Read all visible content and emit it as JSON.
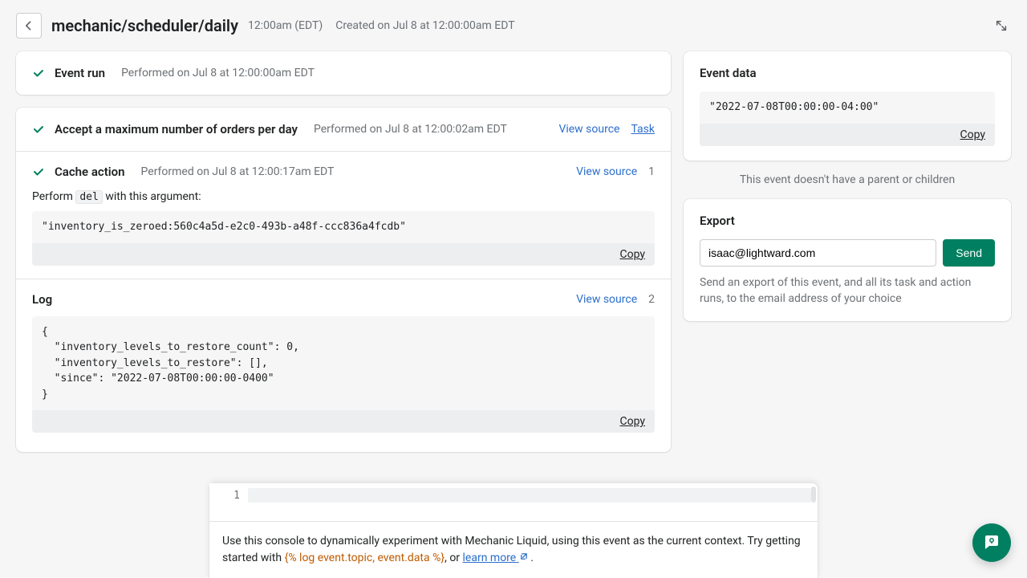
{
  "header": {
    "title": "mechanic/scheduler/daily",
    "time": "12:00am (EDT)",
    "created": "Created on Jul 8 at 12:00:00am EDT"
  },
  "event_run": {
    "title": "Event run",
    "performed": "Performed on Jul 8 at 12:00:00am EDT"
  },
  "task_run": {
    "title": "Accept a maximum number of orders per day",
    "performed": "Performed on Jul 8 at 12:00:02am EDT",
    "view_source": "View source",
    "task_link": "Task"
  },
  "cache_action": {
    "title": "Cache action",
    "performed": "Performed on Jul 8 at 12:00:17am EDT",
    "view_source": "View source",
    "badge": "1",
    "perform_prefix": "Perform ",
    "perform_code": "del",
    "perform_suffix": " with this argument:",
    "argument": "\"inventory_is_zeroed:560c4a5d-e2c0-493b-a48f-ccc836a4fcdb\"",
    "copy": "Copy"
  },
  "log": {
    "title": "Log",
    "view_source": "View source",
    "badge": "2",
    "content": "{\n  \"inventory_levels_to_restore_count\": 0,\n  \"inventory_levels_to_restore\": [],\n  \"since\": \"2022-07-08T00:00:00-0400\"\n}",
    "copy": "Copy"
  },
  "event_data": {
    "title": "Event data",
    "content": "\"2022-07-08T00:00:00-04:00\"",
    "copy": "Copy"
  },
  "parent_msg": "This event doesn't have a parent or children",
  "export": {
    "title": "Export",
    "email_value": "isaac@lightward.com",
    "send": "Send",
    "help": "Send an export of this event, and all its task and action runs, to the email address of your choice"
  },
  "console": {
    "line_num": "1",
    "help_prefix": "Use this console to dynamically experiment with Mechanic Liquid, using this event as the current context. Try getting started with ",
    "liquid": "{% log event.topic, event.data %}",
    "help_mid": ", or ",
    "learn_more": "learn more",
    "help_suffix": " ."
  }
}
